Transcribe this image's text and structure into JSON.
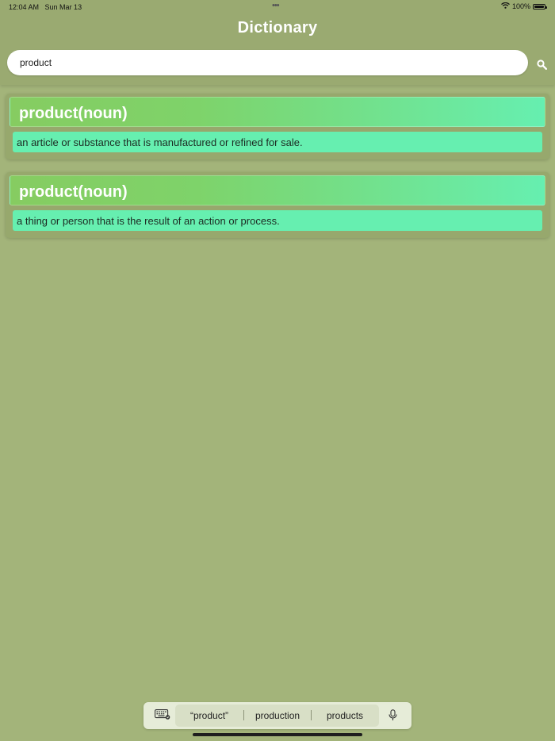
{
  "status_bar": {
    "time": "12:04 AM",
    "date": "Sun Mar 13",
    "dots": "•••",
    "battery_percent": "100%"
  },
  "app": {
    "title": "Dictionary"
  },
  "search": {
    "value": "product",
    "placeholder": ""
  },
  "results": [
    {
      "word": "product(noun)",
      "definition": "an article or substance that is manufactured or refined for sale."
    },
    {
      "word": "product(noun)",
      "definition": "a thing or person that is the result of an action or process."
    }
  ],
  "keyboard_bar": {
    "suggestions": [
      "“product”",
      "production",
      "products"
    ]
  },
  "colors": {
    "background": "#a3b47a",
    "header": "#9aaa71",
    "card_gradient_start": "#86cc61",
    "card_gradient_end": "#66efb0",
    "definition_bg": "#66efb0"
  },
  "icons": {
    "search": "search-icon",
    "wifi": "wifi-icon",
    "battery": "battery-icon",
    "keyboard": "keyboard-icon",
    "microphone": "microphone-icon"
  }
}
